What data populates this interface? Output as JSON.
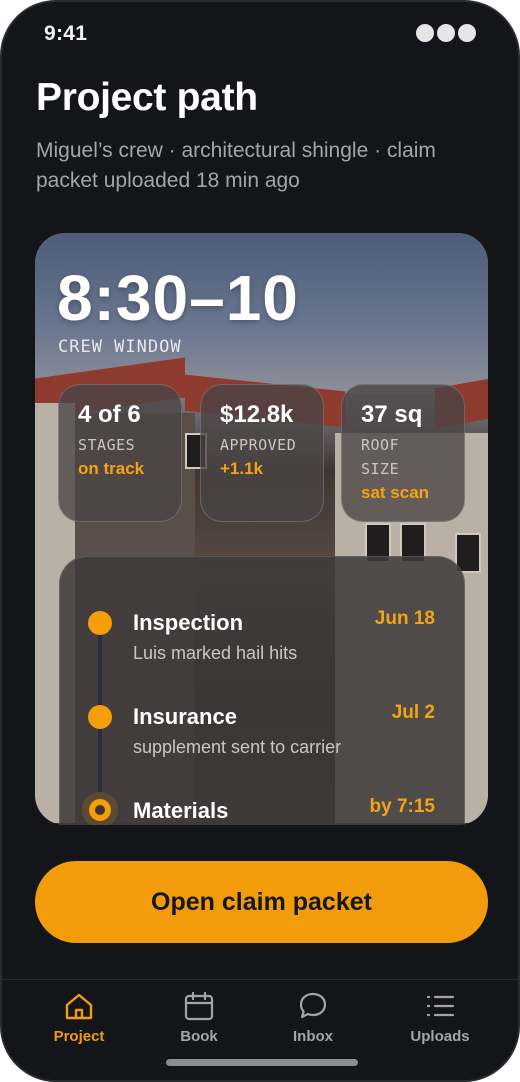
{
  "status_bar": {
    "time": "9:41"
  },
  "header": {
    "title": "Project path",
    "subtitle": "Miguel’s crew · architectural shingle · claim packet uploaded 18 min ago"
  },
  "hero": {
    "time_window": "8:30–10",
    "time_label": "CREW WINDOW",
    "stats": [
      {
        "value": "4 of 6",
        "label": "STAGES",
        "accent": "on track"
      },
      {
        "value": "$12.8k",
        "label": "APPROVED",
        "accent": "+1.1k"
      },
      {
        "value": "37 sq",
        "label": "ROOF SIZE",
        "accent": "sat scan"
      }
    ]
  },
  "timeline": [
    {
      "title": "Inspection",
      "subtitle": "Luis marked hail hits",
      "date": "Jun 18",
      "state": "done"
    },
    {
      "title": "Insurance",
      "subtitle": "supplement sent to carrier",
      "date": "Jul 2",
      "state": "done"
    },
    {
      "title": "Materials",
      "subtitle": "",
      "date": "by 7:15",
      "state": "current"
    }
  ],
  "cta": {
    "label": "Open claim packet"
  },
  "tabs": [
    {
      "label": "Project",
      "icon": "home-icon",
      "active": true
    },
    {
      "label": "Book",
      "icon": "calendar-icon",
      "active": false
    },
    {
      "label": "Inbox",
      "icon": "chat-bubble-icon",
      "active": false
    },
    {
      "label": "Uploads",
      "icon": "list-icon",
      "active": false
    }
  ],
  "colors": {
    "accent": "#f39c0b",
    "background": "#141519",
    "muted_text": "#a3a5ab"
  }
}
